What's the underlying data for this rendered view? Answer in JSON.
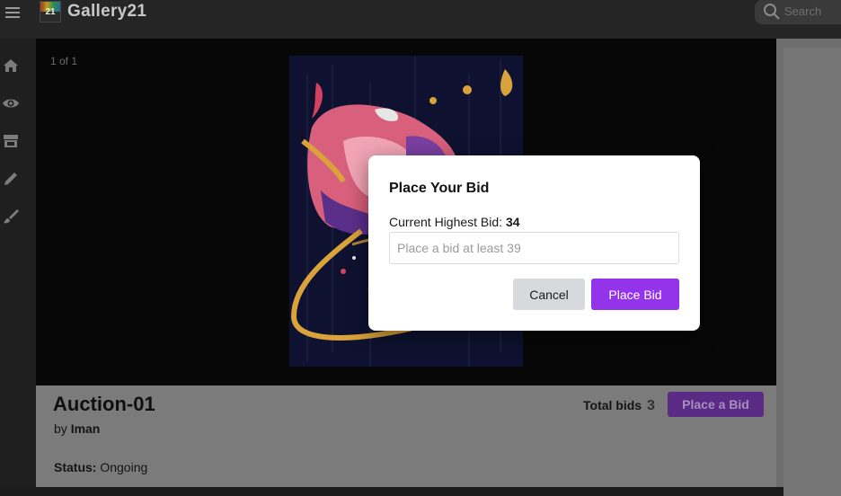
{
  "app": {
    "logo_text": "21",
    "brand": "Gallery21",
    "search_placeholder": "Search"
  },
  "sidebar": {
    "items": [
      {
        "icon": "home-icon"
      },
      {
        "icon": "eye-icon"
      },
      {
        "icon": "store-icon"
      },
      {
        "icon": "pencil-icon"
      },
      {
        "icon": "brush-icon"
      }
    ]
  },
  "viewer": {
    "counter": "1 of 1"
  },
  "auction": {
    "title": "Auction-01",
    "by_prefix": "by",
    "artist": "Iman",
    "status_label": "Status:",
    "status_value": "Ongoing",
    "total_bids_label": "Total bids",
    "total_bids": "3",
    "place_bid_label": "Place a Bid"
  },
  "modal": {
    "title": "Place Your Bid",
    "current_label": "Current Highest Bid:",
    "current_value": "34",
    "input_placeholder": "Place a bid at least 39",
    "input_value": "",
    "cancel_label": "Cancel",
    "submit_label": "Place Bid"
  },
  "colors": {
    "accent": "#9333ea",
    "overlay_topbar": "#252525",
    "cancel_bg": "#d8d9dd"
  }
}
